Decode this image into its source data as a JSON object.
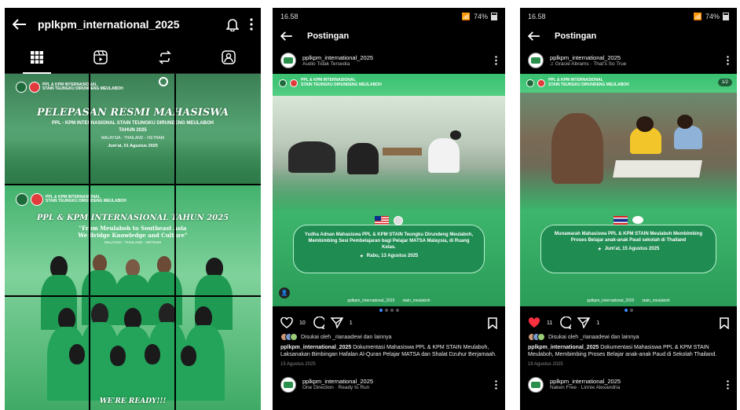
{
  "panel1": {
    "username": "pplkpm_international_2025",
    "tile1": {
      "logo_text_1": "PPL & KPM INTERNASIONAL",
      "logo_text_2": "STAIN TEUNGKU DIRUNDENG MEULABOH",
      "headline": "PELEPASAN RESMI MAHASISWA",
      "subhead": "PPL - KPM INTERNASIONAL STAIN TEUNGKU DIRUNDENG MEULABOH",
      "year": "TAHUN 2025",
      "countries": "MALAYSIA - THAILAND - VIETNAM",
      "date": "Jum'at, 01 Agustus 2025"
    },
    "tile2": {
      "logo_text_1": "PPL & KPM INTERNASIONAL",
      "logo_text_2": "STAIN TEUNGKU DIRUNDENG MEULABOH",
      "headline": "PPL & KPM INTERNASIONAL TAHUN 2025",
      "quote_1": "\"From Meulaboh to Southeast Asia",
      "quote_2": "We Bridge Knowledge and Culture\"",
      "countries": "MALAYSIA - THAILAND - VIETNAM",
      "footer": "WE'RE READY!!!"
    }
  },
  "panel2": {
    "time": "16.58",
    "battery": "74%",
    "title": "Postingan",
    "username": "pplkpm_international_2025",
    "subtitle": "Audio Tidak Tersedia",
    "banner_1": "PPL & KPM INTERNASIONAL",
    "banner_2": "STAIN TEUNGKU DIRUNDENG MEULABOH",
    "caption_text": "Yudha Adnan Mahasiswa PPL & KPM STAIN Teungku Dirundeng Meulaboh, Membimbing Sesi Pembelajaran bagi Pelajar MATSA Malaysia, di Ruang Kelas.",
    "caption_date": "Rabu, 13 Agustus 2025",
    "tag_1": "pplkpm_international_2025",
    "tag_2": "stain_meulaboh",
    "likes": "10",
    "shares": "1",
    "liked_by": "Disukai oleh _rianaadewi dan lainnya",
    "caption_user": "pplkpm_international_2025",
    "caption": "Dokumentasi Mahasiswa PPL & KPM STAIN Meulaboh, Laksanakan Bimbingan Hafalan Al-Quran Pelajar MATSA dan Shalat Dzuhur Berjamaah.",
    "date": "15 Agustus 2025",
    "next_username": "pplkpm_international_2025",
    "next_subtitle": "One Direction · Ready to Run"
  },
  "panel3": {
    "time": "16.58",
    "battery": "74%",
    "title": "Postingan",
    "username": "pplkpm_international_2025",
    "subtitle": "Gracie Abrams · That's So True",
    "banner_1": "PPL & KPM INTERNASIONAL",
    "banner_2": "STAIN TEUNGKU DIRUNDENG MEULABOH",
    "counter": "1/2",
    "caption_text": "Munawarah Mahasiswa PPL & KPM STAIN Meulaboh Membimbing Proses Belajar anak-anak Paud sekolah di Thailand",
    "caption_date": "Jum'at, 15 Agustus 2025",
    "tag_1": "pplkpm_international_2025",
    "tag_2": "stain_meulaboh",
    "likes": "11",
    "shares": "1",
    "liked_by": "Disukai oleh _rianaadewi dan lainnya",
    "caption_user": "pplkpm_international_2025",
    "caption": "Dokumentasi Mahasiswa PPL & KPM STAIN Meulaboh, Membimbing Proses Belajar anak-anak Paud di Sekolah Thailand.",
    "date": "18 Agustus 2025",
    "next_username": "pplkpm_international_2025",
    "next_subtitle": "Naken Free · Linnie Alexandria"
  },
  "colors": {
    "accent_green": "#2fae62",
    "like_red": "#ff3040",
    "dot_blue": "#3c8cff"
  }
}
